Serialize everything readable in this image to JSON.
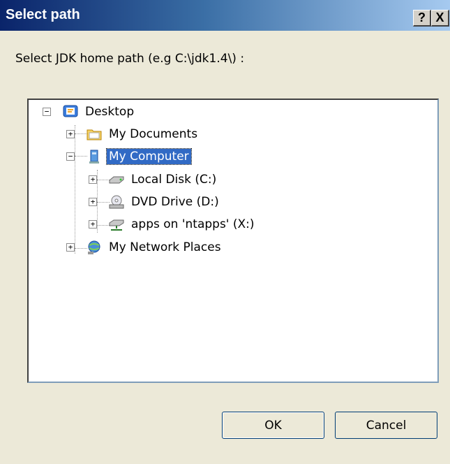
{
  "window": {
    "title": "Select path"
  },
  "title_buttons": {
    "help": "?",
    "close": "X"
  },
  "prompt": "Select JDK home path (e.g C:\\jdk1.4\\) :",
  "tree": [
    {
      "label": "Desktop",
      "expander": "−",
      "icon": "desktop-icon"
    },
    {
      "label": "My Documents",
      "expander": "+",
      "icon": "folder-icon"
    },
    {
      "label": "My Computer",
      "expander": "−",
      "icon": "computer-icon",
      "selected": true
    },
    {
      "label": "Local Disk (C:)",
      "expander": "+",
      "icon": "hard-disk-icon"
    },
    {
      "label": "DVD Drive (D:)",
      "expander": "+",
      "icon": "dvd-drive-icon"
    },
    {
      "label": "apps on 'ntapps' (X:)",
      "expander": "+",
      "icon": "network-drive-icon"
    },
    {
      "label": "My Network Places",
      "expander": "+",
      "icon": "network-places-icon"
    }
  ],
  "buttons": {
    "ok": "OK",
    "cancel": "Cancel"
  },
  "colors": {
    "titlebar_start": "#0a246a",
    "titlebar_end": "#a6caf0",
    "selection": "#316ac5",
    "dialog_bg": "#ece9d8"
  }
}
